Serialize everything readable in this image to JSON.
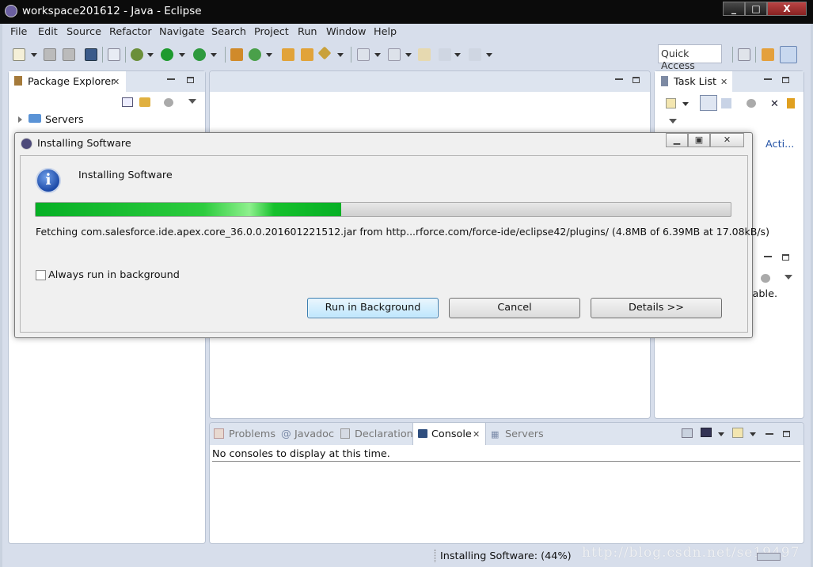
{
  "window": {
    "title": "workspace201612 - Java - Eclipse",
    "minimize": "_",
    "maximize": "□",
    "close": "X"
  },
  "menubar": [
    "File",
    "Edit",
    "Source",
    "Refactor",
    "Navigate",
    "Search",
    "Project",
    "Run",
    "Window",
    "Help"
  ],
  "quick_access": {
    "placeholder": "Quick Access"
  },
  "package_explorer": {
    "title": "Package Explorer",
    "items": [
      {
        "label": "Servers"
      }
    ]
  },
  "task_list": {
    "title": "Task List",
    "link": "Acti..."
  },
  "outline_fragment": {
    "text": "lable."
  },
  "bottom_panel": {
    "tabs": [
      {
        "label": "Problems",
        "active": false
      },
      {
        "label": "Javadoc",
        "active": false
      },
      {
        "label": "Declaration",
        "active": false
      },
      {
        "label": "Console",
        "active": true
      },
      {
        "label": "Servers",
        "active": false
      }
    ],
    "message": "No consoles to display at this time."
  },
  "dialog": {
    "title": "Installing Software",
    "heading": "Installing Software",
    "progress": 0.44,
    "status": "Fetching com.salesforce.ide.apex.core_36.0.0.201601221512.jar from http...rforce.com/force-ide/eclipse42/plugins/ (4.8MB of 6.39MB at 17.08kB/s)",
    "checkbox_label": "Always run in background",
    "checkbox_checked": false,
    "buttons": {
      "run_bg": "Run in Background",
      "cancel": "Cancel",
      "details": "Details >>"
    }
  },
  "statusbar": {
    "text": "Installing Software: (44%)",
    "watermark": "http://blog.csdn.net/se19497"
  },
  "colors": {
    "accent_progress": "#06b025",
    "title_bar": "#0b0b0b",
    "workbench_bg": "#d7deeb",
    "link": "#2453a6"
  }
}
